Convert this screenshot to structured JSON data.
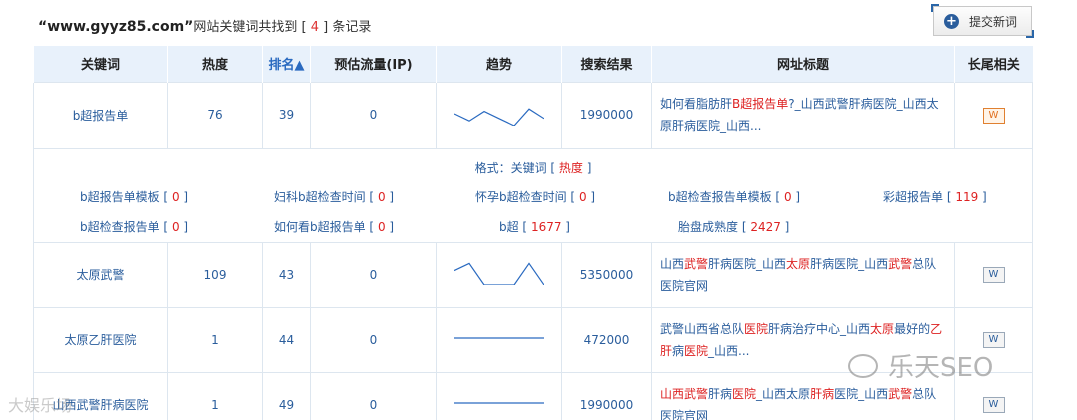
{
  "header": {
    "domain": "“www.gyyz85.com”",
    "text1": "网站关键词共找到 [ ",
    "count": "4",
    "text2": " ] 条记录"
  },
  "submit_button": {
    "label": "提交新词"
  },
  "columns": [
    "关键词",
    "热度",
    "排名▲",
    "预估流量(IP)",
    "趋势",
    "搜索结果",
    "网址标题",
    "长尾相关"
  ],
  "rows": [
    {
      "keyword": "b超报告单",
      "heat": "76",
      "rank": "39",
      "traffic": "0",
      "results": "1990000",
      "title_parts": [
        [
          "如何看脂肪肝",
          false
        ],
        [
          "B超报告单",
          true
        ],
        [
          "?_山西武警肝病医院_山西太原肝病医院_山西...",
          false
        ]
      ],
      "trend": [
        0.5,
        0.2,
        0.6,
        0.3,
        0.0,
        0.7,
        0.3
      ]
    },
    {
      "keyword": "太原武警",
      "heat": "109",
      "rank": "43",
      "traffic": "0",
      "results": "5350000",
      "title_parts": [
        [
          "山西",
          false
        ],
        [
          "武警",
          true
        ],
        [
          "肝病医院_山西",
          false
        ],
        [
          "太原",
          true
        ],
        [
          "肝病医院_山西",
          false
        ],
        [
          "武警",
          true
        ],
        [
          "总队医院官网",
          false
        ]
      ],
      "trend": [
        0.6,
        0.9,
        0.0,
        0.0,
        0.0,
        0.9,
        0.0
      ]
    },
    {
      "keyword": "太原乙肝医院",
      "heat": "1",
      "rank": "44",
      "traffic": "0",
      "results": "472000",
      "title_parts": [
        [
          "武警山西省总队",
          false
        ],
        [
          "医院",
          true
        ],
        [
          "肝病治疗中心_山西",
          false
        ],
        [
          "太原",
          true
        ],
        [
          "最好的",
          false
        ],
        [
          "乙肝",
          true
        ],
        [
          "病",
          false
        ],
        [
          "医院",
          true
        ],
        [
          "_山西...",
          false
        ]
      ],
      "trend": [
        0.5,
        0.5,
        0.5,
        0.5,
        0.5,
        0.5,
        0.5
      ]
    },
    {
      "keyword": "山西武警肝病医院",
      "heat": "1",
      "rank": "49",
      "traffic": "0",
      "results": "1990000",
      "title_parts": [
        [
          "山西武警",
          true
        ],
        [
          "肝病",
          false
        ],
        [
          "医院",
          true
        ],
        [
          "_山西太原",
          false
        ],
        [
          "肝病",
          true
        ],
        [
          "医院_山西",
          false
        ],
        [
          "武警",
          true
        ],
        [
          "总队医院官网",
          false
        ]
      ],
      "trend": [
        0.5,
        0.5,
        0.5,
        0.5,
        0.5,
        0.5,
        0.5
      ]
    }
  ],
  "longtail": {
    "format_label": "格式：关键词 [ ",
    "format_heat": "热度",
    "format_end": " ]",
    "items": [
      {
        "kw": "b超报告单模板",
        "n": "0"
      },
      {
        "kw": "妇科b超检查时间",
        "n": "0"
      },
      {
        "kw": "怀孕b超检查时间",
        "n": "0"
      },
      {
        "kw": "b超检查报告单模板",
        "n": "0"
      },
      {
        "kw": "彩超报告单",
        "n": "119"
      },
      {
        "kw": "b超检查报告单",
        "n": "0"
      },
      {
        "kw": "如何看b超报告单",
        "n": "0"
      },
      {
        "kw": "b超",
        "n": "1677"
      },
      {
        "kw": "胎盘成熟度",
        "n": "2427"
      }
    ]
  },
  "watermark": {
    "text": "乐天SEO",
    "corner": "大娱乐场"
  },
  "colors": {
    "link": "#2a5d9c",
    "highlight": "#dd2222",
    "header_bg": "#e8f1fb"
  }
}
